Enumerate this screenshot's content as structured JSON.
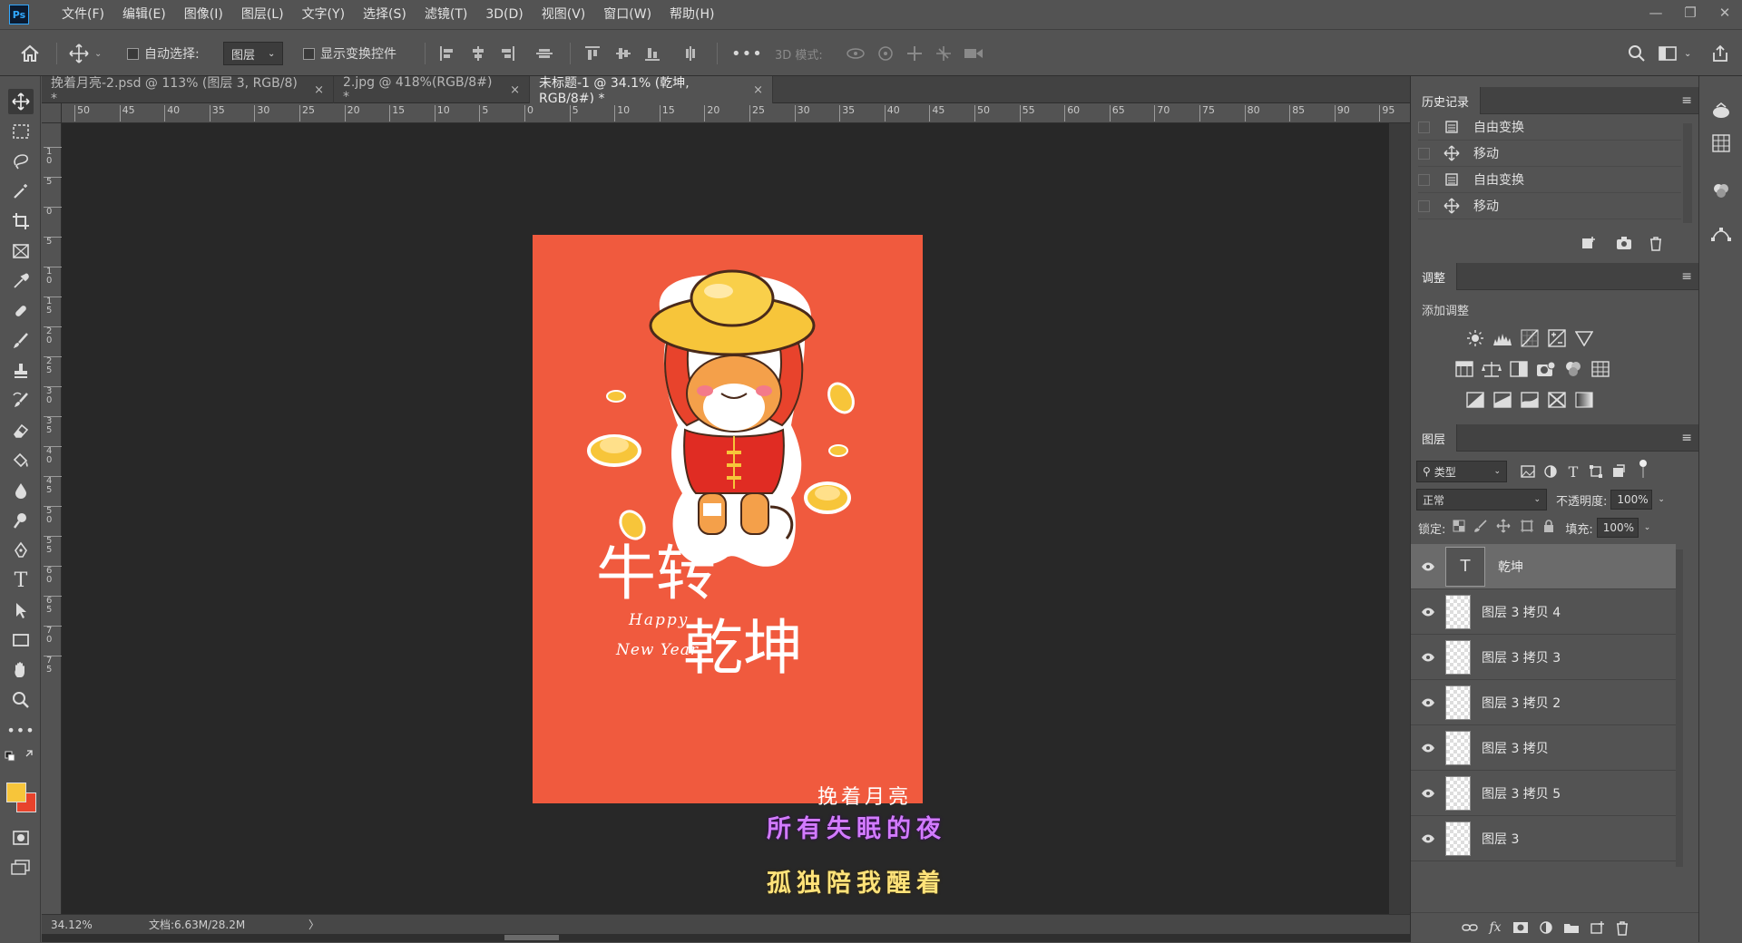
{
  "menubar": {
    "app_icon": "Ps",
    "items": [
      "文件(F)",
      "编辑(E)",
      "图像(I)",
      "图层(L)",
      "文字(Y)",
      "选择(S)",
      "滤镜(T)",
      "3D(D)",
      "视图(V)",
      "窗口(W)",
      "帮助(H)"
    ]
  },
  "options": {
    "auto_select_label": "自动选择:",
    "auto_select_value": "图层",
    "show_transform_label": "显示变换控件",
    "more": "•••",
    "mode_3d_label": "3D 模式:"
  },
  "tabs": [
    {
      "label": "挽着月亮-2.psd @ 113% (图层 3, RGB/8) *",
      "close": "×"
    },
    {
      "label": "2.jpg @ 418%(RGB/8#) *",
      "close": "×"
    },
    {
      "label": "未标题-1 @ 34.1% (乾坤, RGB/8#) *",
      "close": "×"
    }
  ],
  "ruler": {
    "h_ticks": [
      "50",
      "45",
      "40",
      "35",
      "30",
      "25",
      "20",
      "15",
      "10",
      "5",
      "0",
      "5",
      "10",
      "15",
      "20",
      "25",
      "30",
      "35",
      "40",
      "45",
      "50",
      "55",
      "60",
      "65",
      "70",
      "75",
      "80",
      "85",
      "90",
      "95"
    ],
    "v_ticks": [
      "1\n0",
      "5",
      "0",
      "5",
      "1\n0",
      "1\n5",
      "2\n0",
      "2\n5",
      "3\n0",
      "3\n5",
      "4\n0",
      "4\n5",
      "5\n0",
      "5\n5",
      "6\n0",
      "6\n5",
      "7\n0",
      "7\n5"
    ]
  },
  "artwork": {
    "headline_1": "牛转",
    "headline_2": "乾坤",
    "english_1": "Happy",
    "english_2": "New Year",
    "signature": "挽着月亮",
    "bg_color": "#f05a3e"
  },
  "lyrics": {
    "line1": "所有失眠的夜",
    "line2": "孤独陪我醒着",
    "line1_color": "#d27bff",
    "line2_color": "#ffe37a"
  },
  "status": {
    "zoom": "34.12%",
    "doc": "文档:6.63M/28.2M",
    "arrow": "〉"
  },
  "history": {
    "title": "历史记录",
    "items": [
      {
        "label": "自由变换",
        "icon": "document-icon"
      },
      {
        "label": "移动",
        "icon": "move-icon"
      },
      {
        "label": "自由变换",
        "icon": "document-icon"
      },
      {
        "label": "移动",
        "icon": "move-icon"
      }
    ]
  },
  "adjustments": {
    "title": "调整",
    "subtitle": "添加调整"
  },
  "layers": {
    "title": "图层",
    "filter_kind": "类型",
    "blend_mode": "正常",
    "opacity_label": "不透明度:",
    "opacity_value": "100%",
    "lock_label": "锁定:",
    "fill_label": "填充:",
    "fill_value": "100%",
    "items": [
      {
        "name": "乾坤",
        "type": "text",
        "selected": true
      },
      {
        "name": "图层 3 拷贝 4",
        "type": "pixel"
      },
      {
        "name": "图层 3 拷贝 3",
        "type": "pixel"
      },
      {
        "name": "图层 3 拷贝 2",
        "type": "pixel"
      },
      {
        "name": "图层 3 拷贝",
        "type": "pixel"
      },
      {
        "name": "图层 3 拷贝 5",
        "type": "pixel"
      },
      {
        "name": "图层 3",
        "type": "pixel"
      }
    ],
    "footer_fx": "fx"
  },
  "colors": {
    "foreground": "#f7c53a",
    "background": "#e8432c",
    "accent": "#31a8ff"
  }
}
